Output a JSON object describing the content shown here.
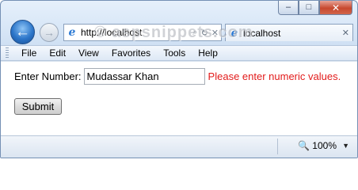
{
  "caption_buttons": {
    "minimize_glyph": "–",
    "maximize_glyph": "□",
    "close_glyph": "✕"
  },
  "navigation": {
    "back_glyph": "←",
    "forward_glyph": "→"
  },
  "address_bar": {
    "url": "http://localhost",
    "search_glyph": "⌕",
    "refresh_glyph": "↻",
    "stop_glyph": "✕"
  },
  "tab": {
    "title": "localhost",
    "close_glyph": "✕"
  },
  "watermark": "© aspsnippets.com",
  "menu": {
    "items": [
      "File",
      "Edit",
      "View",
      "Favorites",
      "Tools",
      "Help"
    ]
  },
  "form": {
    "label": "Enter Number:",
    "input_value": "Mudassar Khan",
    "error_text": "Please enter numeric values.",
    "submit_label": "Submit"
  },
  "status_bar": {
    "zoom": "100%",
    "zoom_glyph": "🔍",
    "dropdown_glyph": "▼"
  },
  "colors": {
    "error": "#e21b1b",
    "accent": "#2b75c9"
  },
  "icons": {
    "ie_logo": "ie-logo-icon",
    "back": "back-arrow-icon",
    "forward": "forward-arrow-icon",
    "zoom": "zoom-magnifier-icon"
  }
}
